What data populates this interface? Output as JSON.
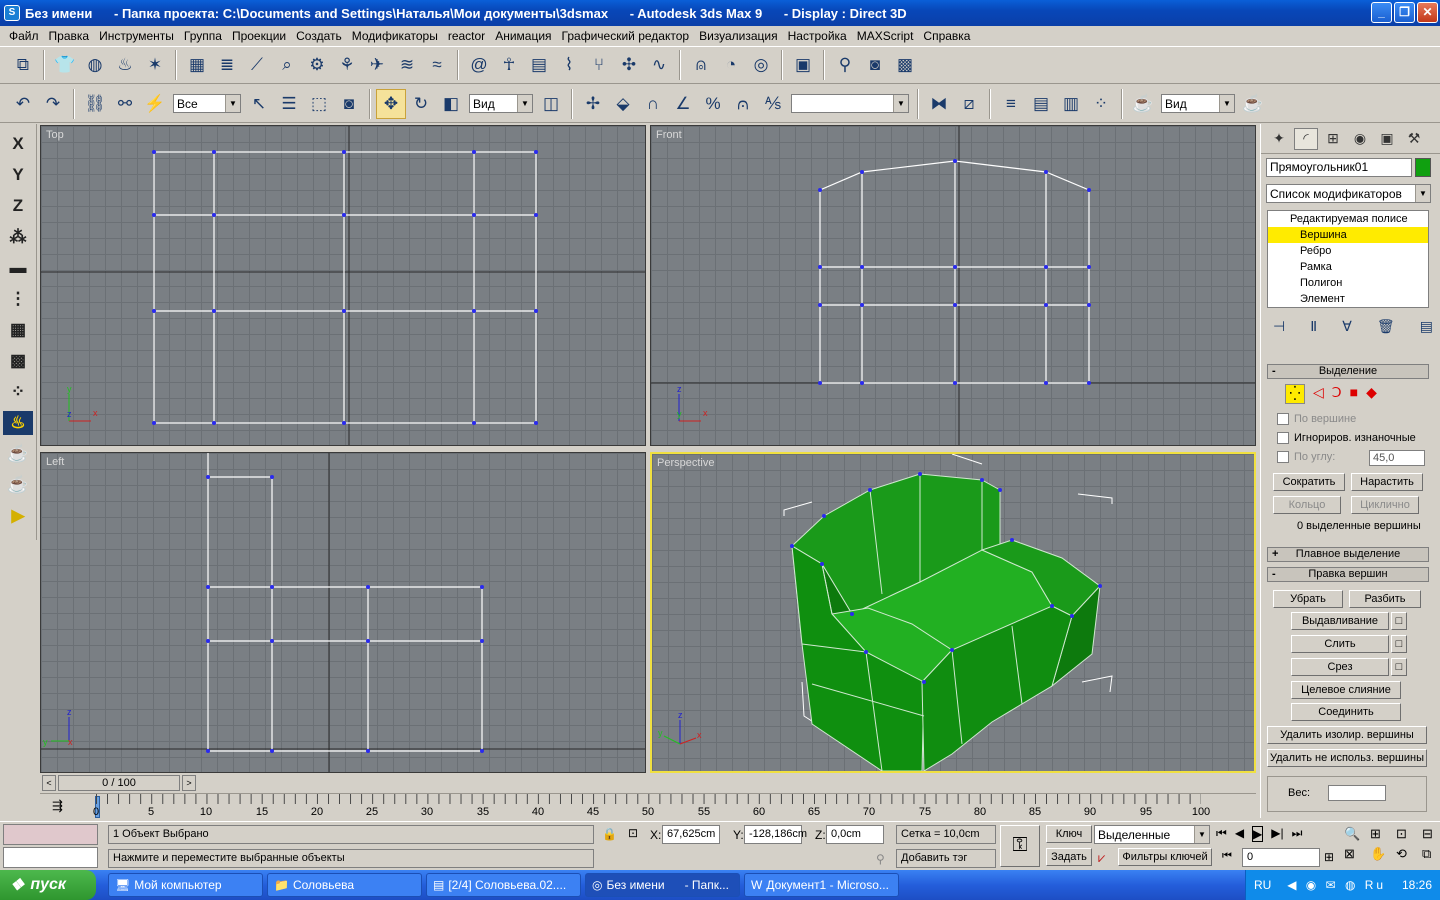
{
  "window": {
    "title": "Без имени      - Папка проекта: C:\\Documents and Settings\\Наталья\\Мои документы\\3dsmax      - Autodesk 3ds Max 9      - Display : Direct 3D"
  },
  "menu": [
    "Файл",
    "Правка",
    "Инструменты",
    "Группа",
    "Проекции",
    "Создать",
    "Модификаторы",
    "reactor",
    "Анимация",
    "Графический редактор",
    "Визуализация",
    "Настройка",
    "MAXScript",
    "Справка"
  ],
  "toolbar2": {
    "selection_filter": "Все",
    "ref_coord": "Вид",
    "named_sel": "",
    "render_type": "Вид"
  },
  "lefttools": [
    "X",
    "Y",
    "Z"
  ],
  "viewports": {
    "top": "Top",
    "front": "Front",
    "left": "Left",
    "perspective": "Perspective"
  },
  "command_panel": {
    "object_name": "Прямоугольник01",
    "modifier_list": "Список модификаторов",
    "stack": [
      "Редактируемая полисе",
      "Вершина",
      "Ребро",
      "Рамка",
      "Полигон",
      "Элемент"
    ],
    "selection": {
      "title": "Выделение",
      "by_vertex": "По вершине",
      "ignore_backfacing": "Игнориров. изнаночные",
      "by_angle": "По углу:",
      "angle": "45,0",
      "shrink": "Сократить",
      "grow": "Нарастить",
      "ring": "Кольцо",
      "loop": "Циклично",
      "info": "0 выделенные вершины"
    },
    "soft_selection": "Плавное выделение",
    "edit_vertices": {
      "title": "Правка вершин",
      "remove": "Убрать",
      "break": "Разбить",
      "extrude": "Выдавливание",
      "weld": "Слить",
      "chamfer": "Срез",
      "target_weld": "Целевое слияние",
      "connect": "Соединить",
      "remove_isolated": "Удалить изолир. вершины",
      "remove_unused": "Удалить не использ. вершины"
    },
    "weight_label": "Вес:"
  },
  "timeslider": {
    "label": "0 / 100",
    "ticks": [
      "0",
      "5",
      "10",
      "15",
      "20",
      "25",
      "30",
      "35",
      "40",
      "45",
      "50",
      "55",
      "60",
      "65",
      "70",
      "75",
      "80",
      "85",
      "90",
      "95",
      "100"
    ]
  },
  "status": {
    "selected": "1 Объект Выбрано",
    "prompt": "Нажмите и переместите выбранные объекты",
    "x_label": "X:",
    "x": "67,625cm",
    "y_label": "Y:",
    "y": "-128,186cm",
    "z_label": "Z:",
    "z": "0,0cm",
    "grid": "Сетка = 10,0cm",
    "add_time_tag": "Добавить тэг врем",
    "key": "Ключ",
    "set": "Задать",
    "selected_dropdown": "Выделенные",
    "key_filters": "Фильтры ключей",
    "frame": "0"
  },
  "taskbar": {
    "start": "пуск",
    "tasks": [
      "Мой компьютер",
      "Соловьева",
      "[2/4] Соловьева.02....",
      "Без имени      - Папк...",
      "Документ1 - Microso..."
    ],
    "lang": "RU",
    "clock": "18:26"
  }
}
